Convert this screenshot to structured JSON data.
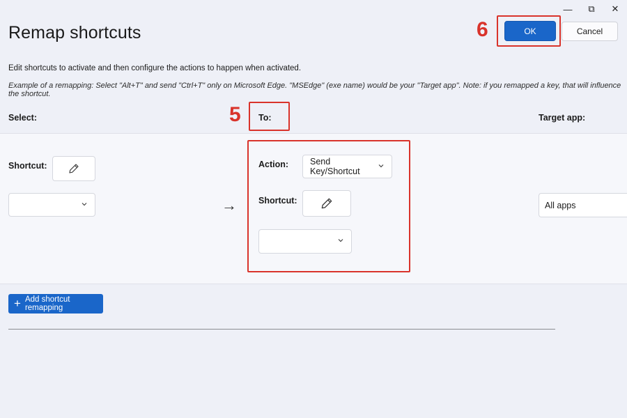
{
  "window": {
    "minimize_glyph": "—",
    "maximize_glyph": "⧉",
    "close_glyph": "✕"
  },
  "header": {
    "title": "Remap shortcuts",
    "ok_label": "OK",
    "cancel_label": "Cancel"
  },
  "description": {
    "line1": "Edit shortcuts to activate and then configure the actions to happen when activated.",
    "line2": "Example of a remapping: Select \"Alt+T\" and send \"Ctrl+T\" only on Microsoft Edge. \"MSEdge\" (exe name) would be your \"Target app\". Note: if you remapped a key, that will influence the shortcut."
  },
  "columns": {
    "select": "Select:",
    "to": "To:",
    "target": "Target app:"
  },
  "row": {
    "select_shortcut_label": "Shortcut:",
    "select_dropdown_value": "",
    "action_label": "Action:",
    "action_value": "Send Key/Shortcut",
    "to_shortcut_label": "Shortcut:",
    "to_dropdown_value": "",
    "target_app_value": "All apps",
    "arrow_glyph": "→"
  },
  "footer": {
    "add_label": "Add shortcut remapping",
    "add_glyph": "+"
  },
  "annotations": {
    "step5": "5",
    "step6": "6",
    "color": "#d9332b"
  },
  "icons": {
    "edit": "pencil-icon",
    "dropdown": "chevron-down-icon",
    "add": "plus-icon"
  }
}
